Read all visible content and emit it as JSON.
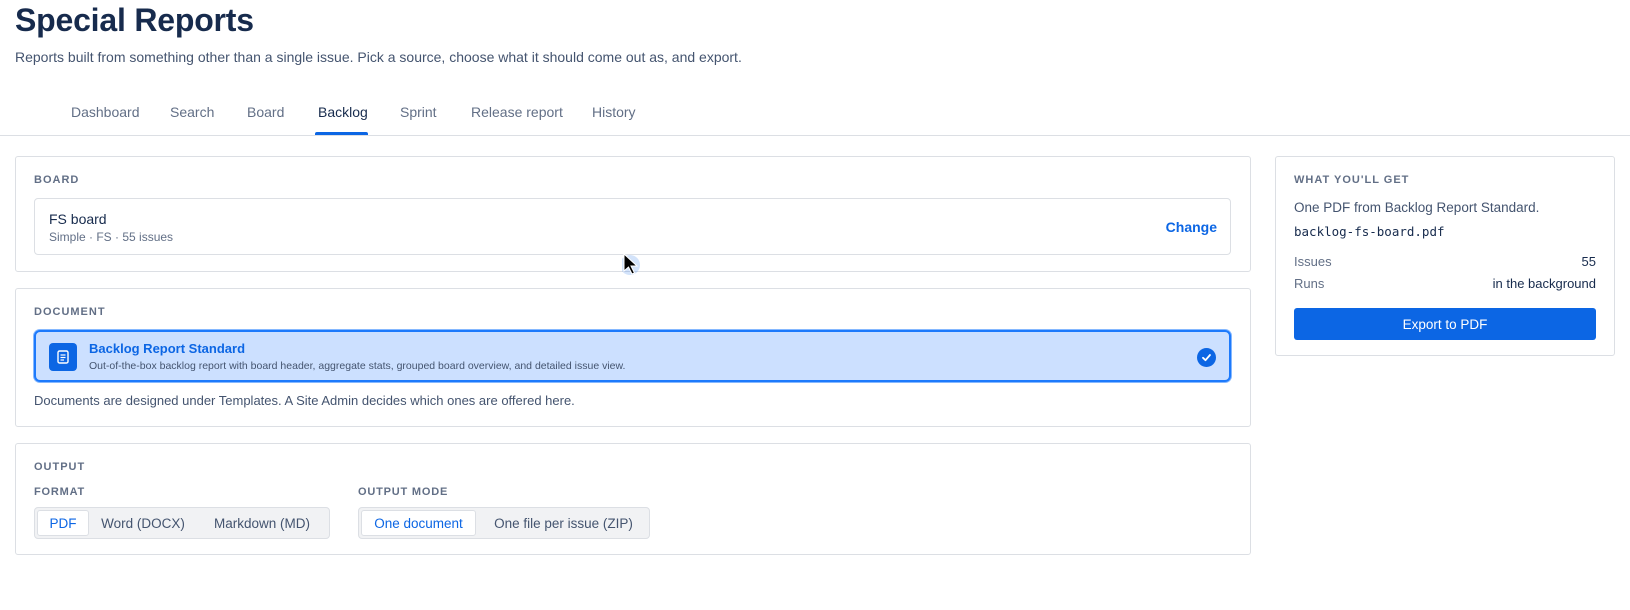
{
  "page": {
    "title": "Special Reports",
    "subtitle": "Reports built from something other than a single issue. Pick a source, choose what it should come out as, and export."
  },
  "tabs": [
    {
      "label": "Dashboard",
      "active": false
    },
    {
      "label": "Search",
      "active": false
    },
    {
      "label": "Board",
      "active": false
    },
    {
      "label": "Backlog",
      "active": true
    },
    {
      "label": "Sprint",
      "active": false
    },
    {
      "label": "Release report",
      "active": false
    },
    {
      "label": "History",
      "active": false
    }
  ],
  "board_section": {
    "label": "BOARD",
    "name": "FS board",
    "meta": "Simple · FS · 55 issues",
    "change_label": "Change"
  },
  "document_section": {
    "label": "DOCUMENT",
    "selected": {
      "title": "Backlog Report Standard",
      "description": "Out-of-the-box backlog report with board header, aggregate stats, grouped board overview, and detailed issue view.",
      "icon": "document-icon",
      "checked": true
    },
    "note": "Documents are designed under Templates. A Site Admin decides which ones are offered here."
  },
  "output_section": {
    "label": "OUTPUT",
    "format": {
      "label": "FORMAT",
      "options": [
        "PDF",
        "Word (DOCX)",
        "Markdown (MD)"
      ],
      "selected": "PDF"
    },
    "mode": {
      "label": "OUTPUT MODE",
      "options": [
        "One document",
        "One file per issue (ZIP)"
      ],
      "selected": "One document"
    }
  },
  "summary": {
    "title": "WHAT YOU'LL GET",
    "line": "One PDF from Backlog Report Standard.",
    "filename": "backlog-fs-board.pdf",
    "rows": [
      {
        "key": "Issues",
        "value": "55"
      },
      {
        "key": "Runs",
        "value": "in the background"
      }
    ],
    "export_label": "Export to PDF"
  },
  "colors": {
    "accent": "#0c66e4",
    "selected_bg": "#cce0ff",
    "border": "#dcdfe4"
  }
}
